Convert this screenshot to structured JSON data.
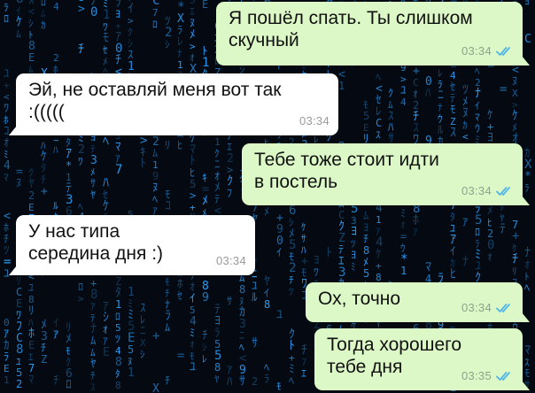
{
  "colors": {
    "background": "#050a12",
    "matrix_glyph": "#2aa2ff",
    "incoming_bubble": "#ffffff",
    "outgoing_bubble": "#dcf8c6",
    "read_receipt": "#4fb6ec"
  },
  "messages": [
    {
      "direction": "outgoing",
      "text": "Я пошёл спать. Ты слишком\n скучный",
      "time": "03:34",
      "status": "read-double-check-icon"
    },
    {
      "direction": "incoming",
      "text": "Эй, не оставляй меня вот так\n:(((((",
      "time": "03:34"
    },
    {
      "direction": "outgoing",
      "text": "Тебе тоже стоит идти\nв постель",
      "time": "03:34",
      "status": "read-double-check-icon"
    },
    {
      "direction": "incoming",
      "text": "У нас типа\nсередина дня :)",
      "time": "03:34"
    },
    {
      "direction": "outgoing",
      "text": "Ох, точно",
      "time": "03:34",
      "status": "read-double-check-icon"
    },
    {
      "direction": "outgoing",
      "text": "Тогда хорошего\nтебе дня",
      "time": "03:35",
      "status": "read-double-check-icon"
    }
  ]
}
